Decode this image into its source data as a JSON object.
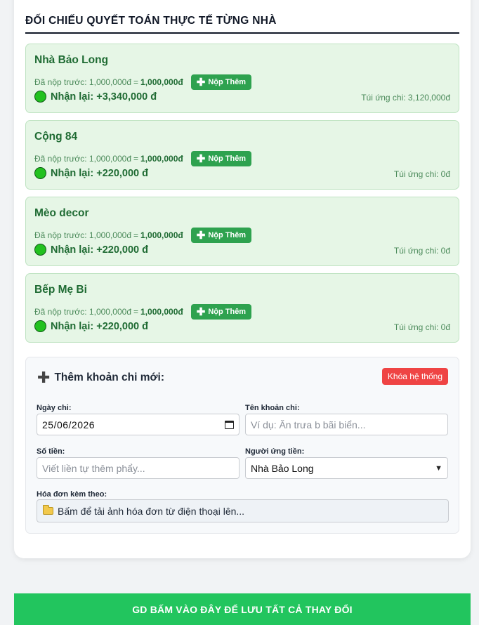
{
  "section_title": "ĐỐI CHIẾU QUYẾT TOÁN THỰC TẾ TỪNG NHÀ",
  "houses": [
    {
      "name": "Nhà Bảo Long",
      "paid_label": "Đã nộp trước: 1,000,000đ",
      "paid_equals": "=",
      "paid_total": "1,000,000đ",
      "add_label": "Nộp Thêm",
      "refund_label": "Nhận lại:",
      "refund_value": "+3,340,000 đ",
      "pocket": "Túi ứng chi: 3,120,000đ"
    },
    {
      "name": "Cộng 84",
      "paid_label": "Đã nộp trước: 1,000,000đ",
      "paid_equals": "=",
      "paid_total": "1,000,000đ",
      "add_label": "Nộp Thêm",
      "refund_label": "Nhận lại:",
      "refund_value": "+220,000 đ",
      "pocket": "Túi ứng chi: 0đ"
    },
    {
      "name": "Mèo decor",
      "paid_label": "Đã nộp trước: 1,000,000đ",
      "paid_equals": "=",
      "paid_total": "1,000,000đ",
      "add_label": "Nộp Thêm",
      "refund_label": "Nhận lại:",
      "refund_value": "+220,000 đ",
      "pocket": "Túi ứng chi: 0đ"
    },
    {
      "name": "Bếp Mẹ Bi",
      "paid_label": "Đã nộp trước: 1,000,000đ",
      "paid_equals": "=",
      "paid_total": "1,000,000đ",
      "add_label": "Nộp Thêm",
      "refund_label": "Nhận lại:",
      "refund_value": "+220,000 đ",
      "pocket": "Túi ứng chi: 0đ"
    }
  ],
  "form": {
    "title": "Thêm khoản chi mới:",
    "lock_label": "Khóa hệ thống",
    "date_label": "Ngày chi:",
    "date_value": "25/06/2026",
    "name_label": "Tên khoản chi:",
    "name_placeholder": "Ví dụ: Ăn trưa b bãi biển...",
    "amount_label": "Số tiền:",
    "amount_placeholder": "Viết liền tự thêm phẩy...",
    "payer_label": "Người ứng tiền:",
    "payer_value": "Nhà Bảo Long",
    "invoice_label": "Hóa đơn kèm theo:",
    "invoice_upload": "Bấm để tải ảnh hóa đơn từ điện thoại lên..."
  },
  "save_label": "GD BẤM VÀO ĐÂY ĐỂ LƯU TẤT CẢ THAY ĐỔI",
  "colors": {
    "card_bg": "#e6f6e6",
    "accent_green": "#2ea24f",
    "save_green": "#22c55e",
    "lock_red": "#ef4444",
    "text_green": "#1f6b33"
  }
}
